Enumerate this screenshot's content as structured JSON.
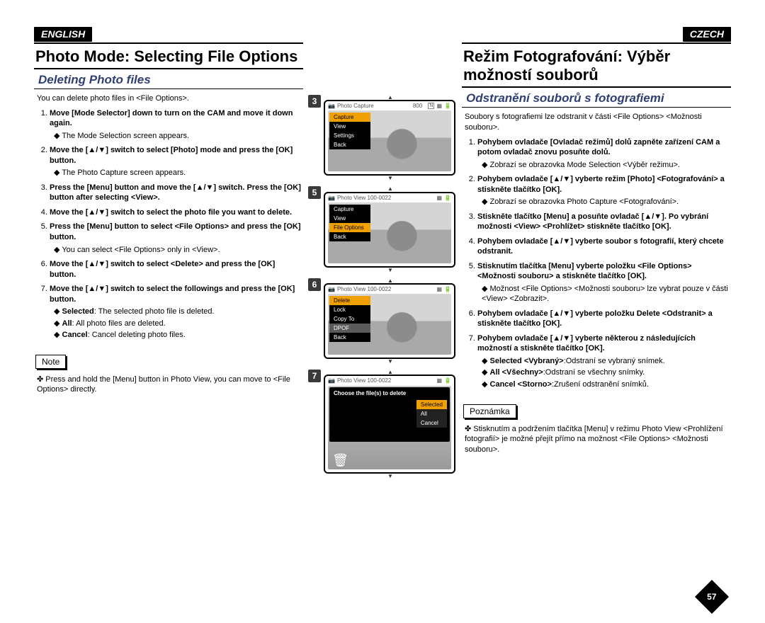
{
  "page_number": "57",
  "left": {
    "lang": "ENGLISH",
    "title": "Photo Mode: Selecting File Options",
    "subhead": "Deleting Photo files",
    "intro": "You can delete photo files in <File Options>.",
    "steps": [
      {
        "t": "Move [Mode Selector] down to turn on the CAM and move it down again.",
        "sub": [
          "The Mode Selection screen appears."
        ]
      },
      {
        "t": "Move the [▲/▼] switch to select [Photo] mode and press the [OK] button.",
        "sub": [
          "The Photo Capture screen appears."
        ]
      },
      {
        "t": "Press the [Menu] button and move the [▲/▼] switch. Press the [OK] button after selecting <View>.",
        "sub": []
      },
      {
        "t": "Move the [▲/▼] switch to select the photo file you want to delete.",
        "sub": []
      },
      {
        "t": "Press the [Menu] button to select <File Options> and press the [OK] button.",
        "sub": [
          "You can select <File Options> only in <View>."
        ]
      },
      {
        "t": "Move the [▲/▼] switch to select <Delete> and press the [OK] button.",
        "sub": []
      },
      {
        "t": "Move the [▲/▼] switch to select the followings and press the [OK] button.",
        "sub": [
          "Selected: The selected photo file is deleted.",
          "All: All photo files are deleted.",
          "Cancel: Cancel deleting photo files."
        ]
      }
    ],
    "note_label": "Note",
    "note": "Press and hold the [Menu] button in Photo View, you can move to <File Options> directly."
  },
  "right": {
    "lang": "CZECH",
    "title": "Režim Fotografování: Výběr možností souborů",
    "subhead": "Odstranění souborů s fotografiemi",
    "intro": "Soubory s fotografiemi lze odstranit v části <File Options> <Možnosti souboru>.",
    "steps": [
      {
        "t": "Pohybem ovladače [Ovladač režimů] dolů zapněte zařízení CAM a potom ovladač znovu posuňte dolů.",
        "sub": [
          "Zobrazí se obrazovka Mode Selection <Výběr režimu>."
        ]
      },
      {
        "t": "Pohybem ovladače [▲/▼] vyberte režim [Photo] <Fotografování> a stiskněte tlačítko [OK].",
        "sub": [
          "Zobrazí se obrazovka Photo Capture <Fotografování>."
        ]
      },
      {
        "t": "Stiskněte tlačítko [Menu] a posuňte ovladač [▲/▼]. Po vybrání možnosti <View> <Prohlížet> stiskněte tlačítko [OK].",
        "sub": []
      },
      {
        "t": "Pohybem ovladače [▲/▼] vyberte soubor s fotografií, který chcete odstranit.",
        "sub": []
      },
      {
        "t": "Stisknutím tlačítka [Menu] vyberte položku <File Options> <Možnosti souboru> a stiskněte tlačítko [OK].",
        "sub": [
          "Možnost <File Options> <Možnosti souboru> lze vybrat pouze v části <View> <Zobrazit>."
        ]
      },
      {
        "t": "Pohybem ovladače [▲/▼] vyberte položku Delete <Odstranit> a stiskněte tlačítko [OK].",
        "sub": []
      },
      {
        "t": "Pohybem ovladače [▲/▼] vyberte některou z následujících možností a stiskněte tlačítko [OK].",
        "sub": [
          "Selected <Vybraný>:Odstraní se vybraný snímek.",
          "All <Všechny>:Odstraní se všechny snímky.",
          "Cancel <Storno>:Zrušení odstranění snímků."
        ]
      }
    ],
    "note_label": "Poznámka",
    "note": "Stisknutím a podržením tlačítka [Menu] v režimu Photo View <Prohlížení fotografií> je možné přejít přímo na možnost <File Options> <Možnosti souboru>."
  },
  "screens": {
    "s3": {
      "num": "3",
      "title": "Photo Capture",
      "badge": "800",
      "menu": [
        "Capture",
        "View",
        "Settings",
        "Back"
      ],
      "sel": 0
    },
    "s5": {
      "num": "5",
      "title": "Photo View 100-0022",
      "menu": [
        "Capture",
        "View",
        "File Options",
        "Back"
      ],
      "sel": 2
    },
    "s6": {
      "num": "6",
      "title": "Photo View 100-0022",
      "menu": [
        "Delete",
        "Lock",
        "Copy To",
        "DPOF",
        "Back"
      ],
      "sel": 0,
      "gray_idx": 3
    },
    "s7": {
      "num": "7",
      "title": "Photo View 100-0022",
      "dialog": "Choose the file(s) to delete",
      "options": [
        "Selected",
        "All",
        "Cancel"
      ],
      "sel": 0
    }
  }
}
